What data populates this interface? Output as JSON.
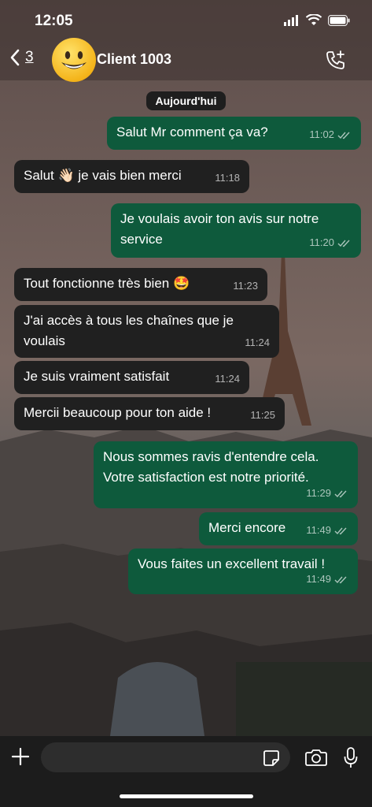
{
  "status_bar": {
    "time": "12:05"
  },
  "header": {
    "back_count": "3",
    "contact_name": "Client 1003"
  },
  "day_chip": "Aujourd'hui",
  "messages": [
    {
      "dir": "out",
      "text": "Salut Mr comment ça va?",
      "time": "11:02"
    },
    {
      "dir": "in",
      "text": "Salut 👋🏻 je vais bien merci",
      "time": "11:18"
    },
    {
      "dir": "out",
      "text": "Je voulais avoir ton avis sur notre service",
      "time": "11:20"
    },
    {
      "dir": "in",
      "text": "Tout fonctionne très bien 🤩",
      "time": "11:23"
    },
    {
      "dir": "in",
      "text": "J'ai accès à tous les chaînes que je voulais",
      "time": "11:24"
    },
    {
      "dir": "in",
      "text": "Je suis vraiment satisfait",
      "time": "11:24"
    },
    {
      "dir": "in",
      "text": "Mercii beaucoup pour ton aide !",
      "time": "11:25"
    },
    {
      "dir": "out",
      "text": "Nous sommes ravis d'entendre cela. Votre satisfaction est notre priorité.",
      "time": "11:29"
    },
    {
      "dir": "out",
      "text": "Merci encore",
      "time": "11:49"
    },
    {
      "dir": "out",
      "text": "Vous faites un excellent travail !",
      "time": "11:49"
    }
  ],
  "composer": {
    "placeholder": ""
  },
  "icons": {
    "back": "chevron-left-icon",
    "call_add": "phone-plus-icon",
    "read_receipt": "double-check-icon",
    "attach": "plus-icon",
    "sticker": "sticker-icon",
    "camera": "camera-icon",
    "mic": "microphone-icon"
  },
  "colors": {
    "incoming_bubble": "#202020",
    "outgoing_bubble": "#0e5a3c"
  }
}
